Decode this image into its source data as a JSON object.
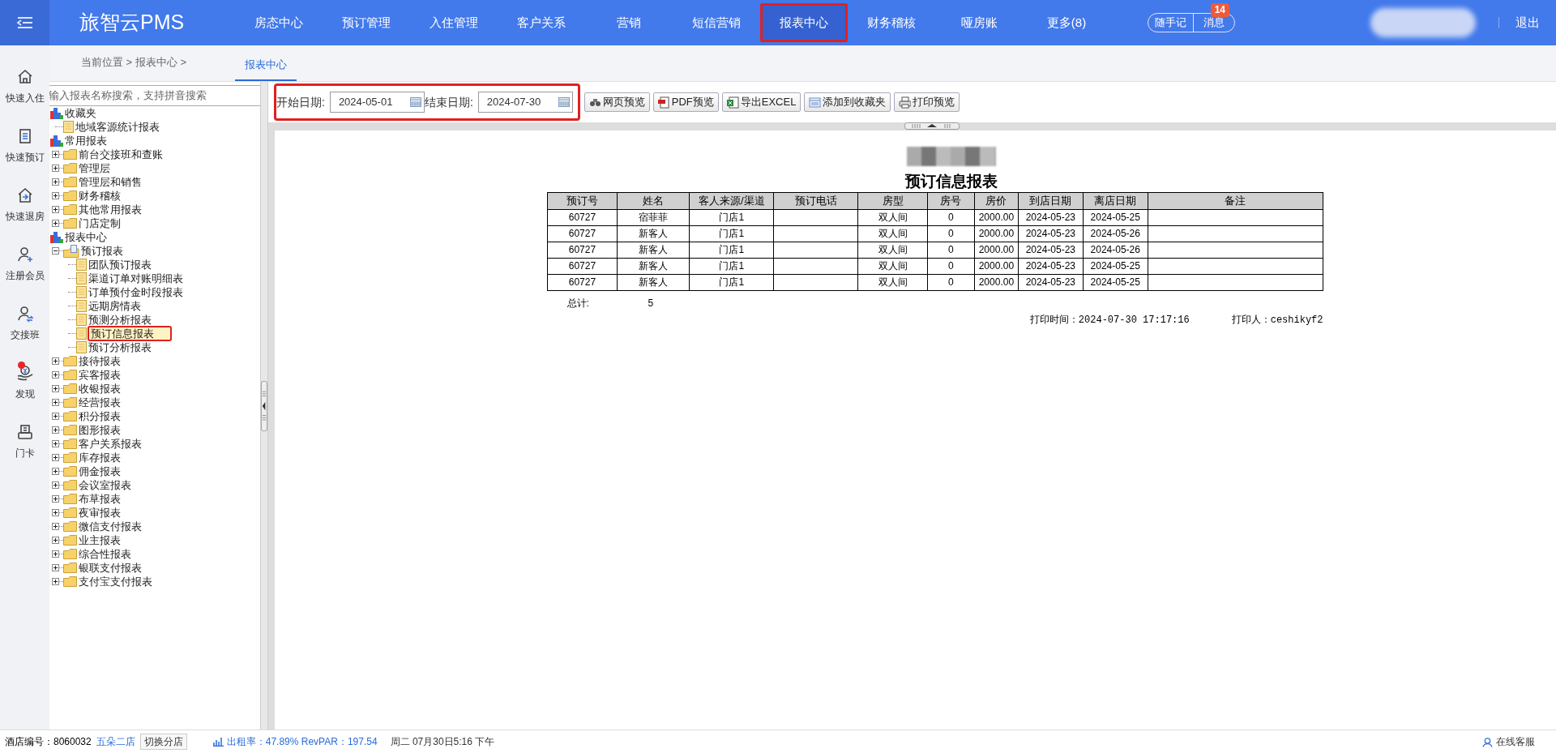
{
  "header": {
    "logo": "旅智云PMS",
    "nav": [
      {
        "label": "房态中心",
        "selected": false
      },
      {
        "label": "预订管理",
        "selected": false
      },
      {
        "label": "入住管理",
        "selected": false
      },
      {
        "label": "客户关系",
        "selected": false
      },
      {
        "label": "营销",
        "selected": false
      },
      {
        "label": "短信营销",
        "selected": false
      },
      {
        "label": "报表中心",
        "selected": true,
        "highlighted": true
      },
      {
        "label": "财务稽核",
        "selected": false
      },
      {
        "label": "哑房账",
        "selected": false
      },
      {
        "label": "更多(8)",
        "selected": false
      }
    ],
    "notes_button": "随手记",
    "messages_button": "消息",
    "messages_badge": "14",
    "logout": "退出"
  },
  "quick_rail": [
    {
      "label": "快速入住",
      "kind": "checkin",
      "dot": false
    },
    {
      "label": "快速预订",
      "kind": "booking",
      "dot": false
    },
    {
      "label": "快速退房",
      "kind": "checkout",
      "dot": false
    },
    {
      "label": "注册会员",
      "kind": "member",
      "dot": false
    },
    {
      "label": "交接班",
      "kind": "shift",
      "dot": false
    },
    {
      "label": "发现",
      "kind": "discover",
      "dot": true
    },
    {
      "label": "门卡",
      "kind": "card",
      "dot": false
    }
  ],
  "breadcrumb": {
    "text": "当前位置 > 报表中心 >",
    "tabs": [
      {
        "label": "报表中心",
        "selected": true
      }
    ]
  },
  "report_tree": {
    "search_placeholder": "输入报表名称搜索，支持拼音搜索",
    "items": [
      {
        "label": "收藏夹",
        "kind": "root",
        "children": [
          {
            "label": "地域客源统计报表",
            "kind": "leaf",
            "selected": false
          }
        ]
      },
      {
        "label": "常用报表",
        "kind": "root",
        "children": [
          {
            "label": "前台交接班和查账",
            "kind": "folder",
            "expanded": false
          },
          {
            "label": "管理层",
            "kind": "folder",
            "expanded": false
          },
          {
            "label": "管理层和销售",
            "kind": "folder",
            "expanded": false
          },
          {
            "label": "财务稽核",
            "kind": "folder",
            "expanded": false
          },
          {
            "label": "其他常用报表",
            "kind": "folder",
            "expanded": false
          },
          {
            "label": "门店定制",
            "kind": "folder",
            "expanded": false
          }
        ]
      },
      {
        "label": "报表中心",
        "kind": "root",
        "children": [
          {
            "label": "预订报表",
            "kind": "folder",
            "expanded": true,
            "children": [
              {
                "label": "团队预订报表",
                "kind": "leaf",
                "selected": false
              },
              {
                "label": "渠道订单对账明细表",
                "kind": "leaf",
                "selected": false
              },
              {
                "label": "订单预付金时段报表",
                "kind": "leaf",
                "selected": false
              },
              {
                "label": "远期房情表",
                "kind": "leaf",
                "selected": false
              },
              {
                "label": "预测分析报表",
                "kind": "leaf",
                "selected": false
              },
              {
                "label": "预订信息报表",
                "kind": "leaf",
                "selected": true
              },
              {
                "label": "预订分析报表",
                "kind": "leaf",
                "selected": false
              }
            ]
          },
          {
            "label": "接待报表",
            "kind": "folder",
            "expanded": false
          },
          {
            "label": "宾客报表",
            "kind": "folder",
            "expanded": false
          },
          {
            "label": "收银报表",
            "kind": "folder",
            "expanded": false
          },
          {
            "label": "经营报表",
            "kind": "folder",
            "expanded": false
          },
          {
            "label": "积分报表",
            "kind": "folder",
            "expanded": false
          },
          {
            "label": "图形报表",
            "kind": "folder",
            "expanded": false
          },
          {
            "label": "客户关系报表",
            "kind": "folder",
            "expanded": false
          },
          {
            "label": "库存报表",
            "kind": "folder",
            "expanded": false
          },
          {
            "label": "佣金报表",
            "kind": "folder",
            "expanded": false
          },
          {
            "label": "会议室报表",
            "kind": "folder",
            "expanded": false
          },
          {
            "label": "布草报表",
            "kind": "folder",
            "expanded": false
          },
          {
            "label": "夜审报表",
            "kind": "folder",
            "expanded": false
          },
          {
            "label": "微信支付报表",
            "kind": "folder",
            "expanded": false
          },
          {
            "label": "业主报表",
            "kind": "folder",
            "expanded": false
          },
          {
            "label": "综合性报表",
            "kind": "folder",
            "expanded": false
          },
          {
            "label": "银联支付报表",
            "kind": "folder",
            "expanded": false
          },
          {
            "label": "支付宝支付报表",
            "kind": "folder",
            "expanded": false
          }
        ]
      }
    ]
  },
  "toolbar": {
    "start_label": "开始日期:",
    "start_value": "2024-05-01",
    "end_label": "结束日期:",
    "end_value": "2024-07-30",
    "buttons": [
      {
        "label": "网页预览",
        "kind": "web"
      },
      {
        "label": "PDF预览",
        "kind": "pdf"
      },
      {
        "label": "导出EXCEL",
        "kind": "excel"
      },
      {
        "label": "添加到收藏夹",
        "kind": "favorite"
      },
      {
        "label": "打印预览",
        "kind": "print"
      }
    ]
  },
  "report": {
    "title": "预订信息报表",
    "columns": [
      "预订号",
      "姓名",
      "客人来源/渠道",
      "预订电话",
      "房型",
      "房号",
      "房价",
      "到店日期",
      "离店日期",
      "备注"
    ],
    "rows": [
      [
        "60727",
        "宿菲菲",
        "门店1",
        "",
        "双人间",
        "0",
        "2000.00",
        "2024-05-23",
        "2024-05-25",
        ""
      ],
      [
        "60727",
        "新客人",
        "门店1",
        "",
        "双人间",
        "0",
        "2000.00",
        "2024-05-23",
        "2024-05-26",
        ""
      ],
      [
        "60727",
        "新客人",
        "门店1",
        "",
        "双人间",
        "0",
        "2000.00",
        "2024-05-23",
        "2024-05-26",
        ""
      ],
      [
        "60727",
        "新客人",
        "门店1",
        "",
        "双人间",
        "0",
        "2000.00",
        "2024-05-23",
        "2024-05-25",
        ""
      ],
      [
        "60727",
        "新客人",
        "门店1",
        "",
        "双人间",
        "0",
        "2000.00",
        "2024-05-23",
        "2024-05-25",
        ""
      ]
    ],
    "total_label": "总计:",
    "total_value": "5",
    "print_time": "打印时间：2024-07-30 17:17:16",
    "printer": "打印人：ceshikyf2"
  },
  "status_bar": {
    "hotel_label": "酒店编号：8060032",
    "hotel_name": "五朵二店",
    "switch_button": "切换分店",
    "stats": "出租率：47.89% RevPAR：197.54",
    "datetime": "周二 07月30日5:16 下午",
    "support": "在线客服"
  }
}
